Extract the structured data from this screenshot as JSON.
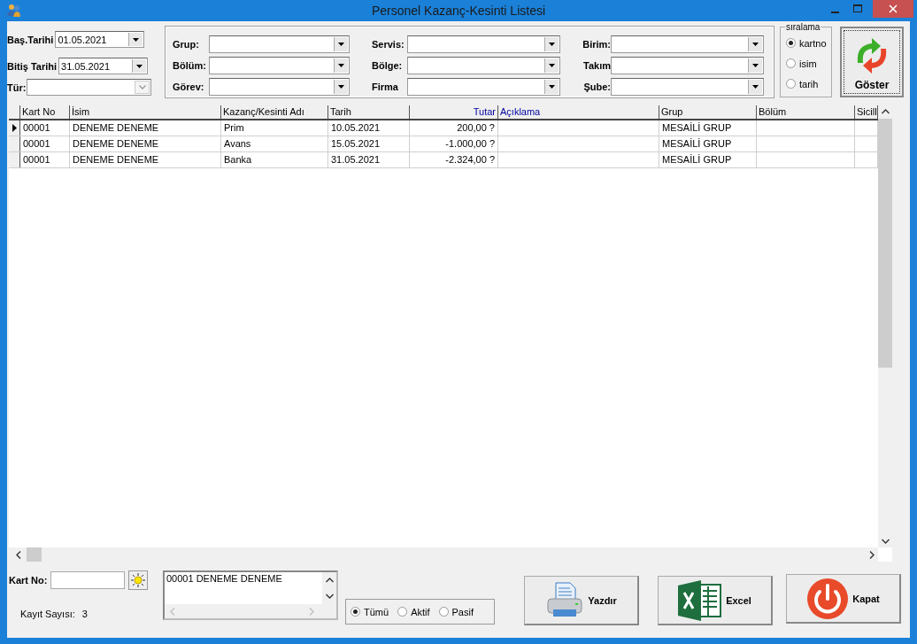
{
  "window": {
    "title": "Personel Kazanç-Kesinti Listesi"
  },
  "dates": [
    {
      "label": "Baş.Tarihi",
      "value": "01.05.2021"
    },
    {
      "label": "Bitiş Tarihi",
      "value": "31.05.2021"
    }
  ],
  "type_filter": {
    "label": "Tür:",
    "disabled": true
  },
  "filter_columns": [
    {
      "fields": [
        {
          "label": "Grup:"
        },
        {
          "label": "Bölüm:"
        },
        {
          "label": "Görev:"
        }
      ]
    },
    {
      "fields": [
        {
          "label": "Servis:"
        },
        {
          "label": "Bölge:"
        },
        {
          "label": "Firma"
        }
      ]
    },
    {
      "fields": [
        {
          "label": "Birim:"
        },
        {
          "label": "Takım"
        },
        {
          "label": "Şube:"
        }
      ]
    }
  ],
  "sort": {
    "title": "sıralama",
    "options": [
      {
        "label": "kartno",
        "selected": true
      },
      {
        "label": "isim",
        "selected": false
      },
      {
        "label": "tarih",
        "selected": false
      }
    ]
  },
  "show_button": "Göster",
  "table": {
    "columns": [
      {
        "label": "Kart No",
        "kind": "text",
        "highlighted": false
      },
      {
        "label": "İsim",
        "kind": "text",
        "highlighted": false
      },
      {
        "label": "Kazanç/Kesinti Adı",
        "kind": "text",
        "highlighted": false
      },
      {
        "label": "Tarih",
        "kind": "text",
        "highlighted": false
      },
      {
        "label": "Tutar",
        "kind": "amount",
        "highlighted": true
      },
      {
        "label": "Açıklama",
        "kind": "text",
        "highlighted": true
      },
      {
        "label": "Grup",
        "kind": "text",
        "highlighted": false
      },
      {
        "label": "Bölüm",
        "kind": "text",
        "highlighted": false
      },
      {
        "label": "Sicill",
        "kind": "text",
        "highlighted": false
      }
    ],
    "rows": [
      {
        "selected": true,
        "cells": [
          "00001",
          "DENEME DENEME",
          "Prim",
          "10.05.2021",
          "200,00 ?",
          null,
          "MESAİLİ GRUP",
          null,
          null
        ]
      },
      {
        "selected": false,
        "cells": [
          "00001",
          "DENEME DENEME",
          "Avans",
          "15.05.2021",
          "-1.000,00 ?",
          null,
          "MESAİLİ GRUP",
          null,
          null
        ]
      },
      {
        "selected": false,
        "cells": [
          "00001",
          "DENEME DENEME",
          "Banka",
          "31.05.2021",
          "-2.324,00 ?",
          null,
          "MESAİLİ GRUP",
          null,
          null
        ]
      }
    ]
  },
  "card_no": {
    "label": "Kart No:"
  },
  "employee_list": [
    "00001 DENEME DENEME"
  ],
  "status_filter": [
    {
      "label": "Tümü",
      "selected": true
    },
    {
      "label": "Aktif",
      "selected": false
    },
    {
      "label": "Pasif",
      "selected": false
    }
  ],
  "record_count": {
    "label": "Kayıt Sayısı:",
    "value": "3"
  },
  "buttons": [
    {
      "label": "Yazdır",
      "kind": "print"
    },
    {
      "label": "Excel",
      "kind": "excel"
    },
    {
      "label": "Kapat",
      "kind": "close"
    }
  ]
}
